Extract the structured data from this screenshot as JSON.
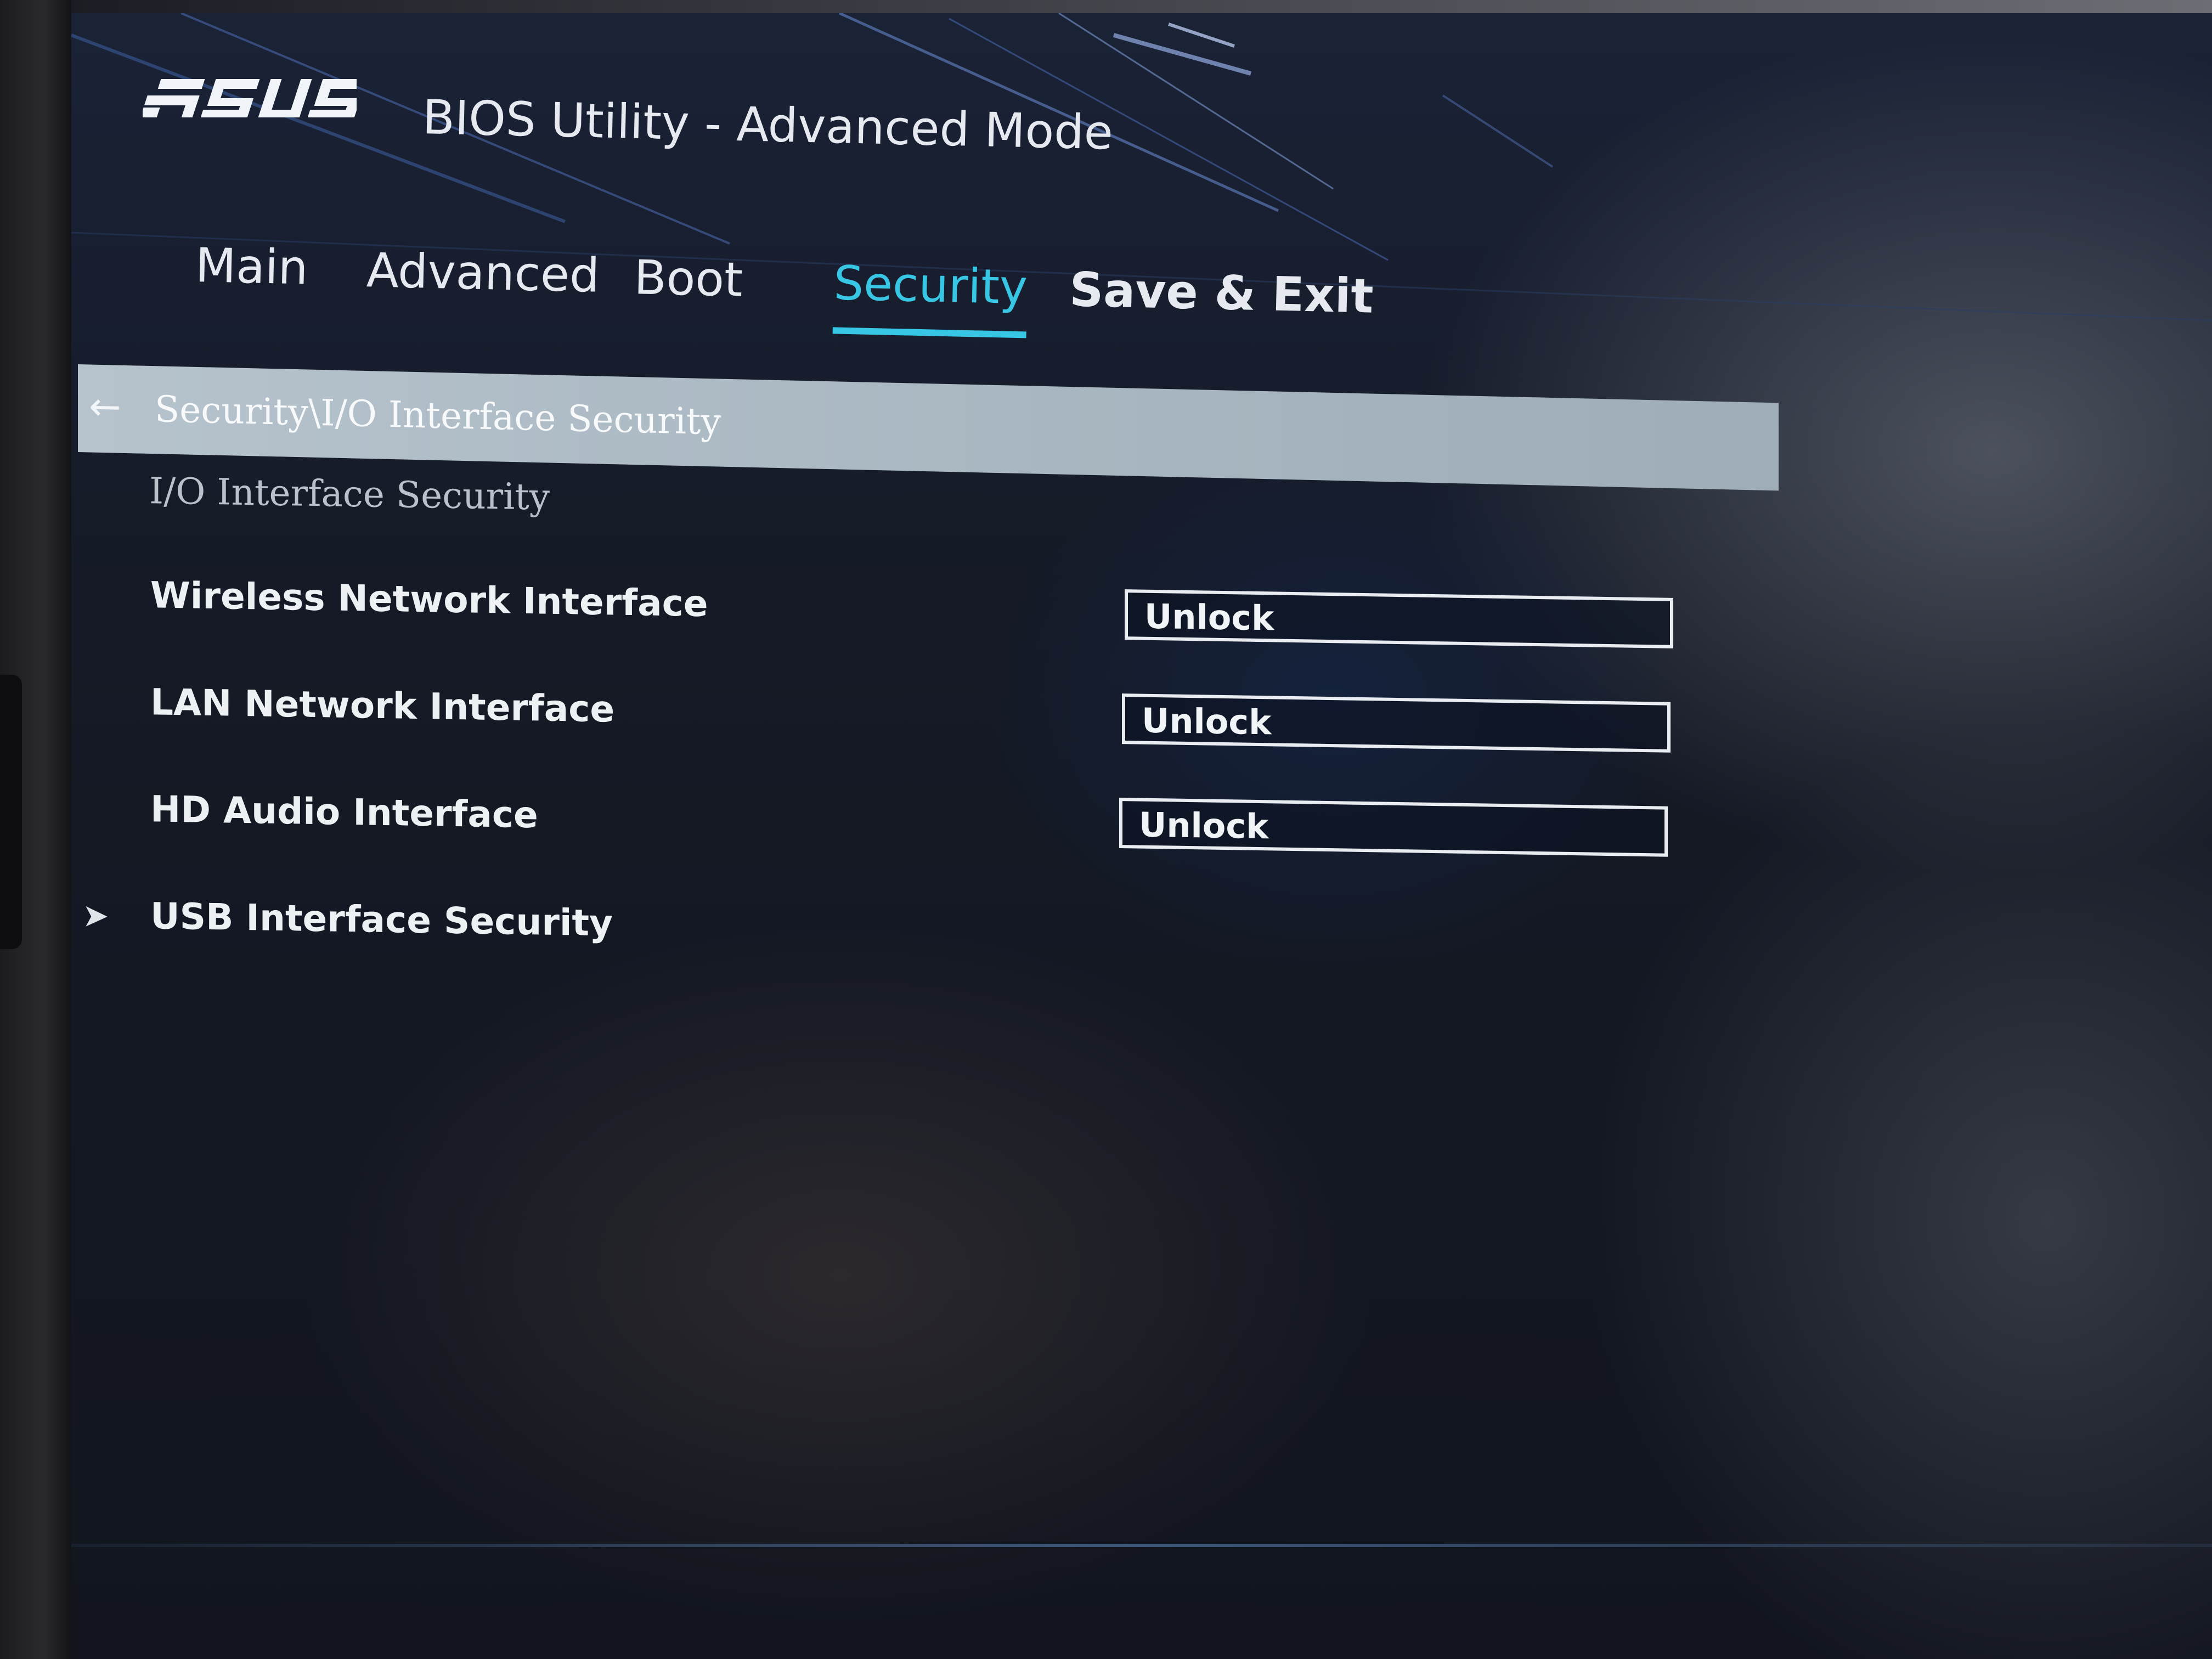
{
  "app": {
    "brand": "ASUS",
    "title": "BIOS Utility - Advanced Mode"
  },
  "tabs": [
    {
      "label": "Main"
    },
    {
      "label": "Advanced"
    },
    {
      "label": "Boot"
    },
    {
      "label": "Security",
      "active": true
    },
    {
      "label": "Save & Exit"
    }
  ],
  "breadcrumb": {
    "text": "Security\\I/O Interface Security"
  },
  "section": {
    "title": "I/O Interface Security"
  },
  "settings": [
    {
      "label": "Wireless Network Interface",
      "value": "Unlock"
    },
    {
      "label": "LAN Network Interface",
      "value": "Unlock"
    },
    {
      "label": "HD Audio Interface",
      "value": "Unlock"
    }
  ],
  "submenus": [
    {
      "label": "USB Interface Security"
    }
  ],
  "colors": {
    "accent": "#37c6e4",
    "highlight_bar": "#b6c3cd",
    "text": "#eef1f4"
  }
}
